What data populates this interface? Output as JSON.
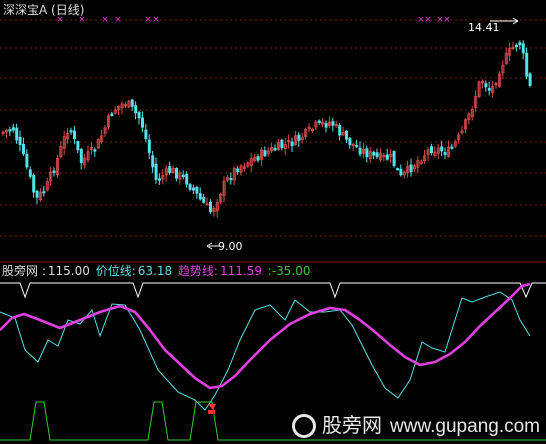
{
  "window": {
    "title": "深深宝A (日线)"
  },
  "price_panel": {
    "high_label": "14.41",
    "low_label": "9.00"
  },
  "indicator": {
    "name_label": "股旁网 :",
    "name_value": "115.00",
    "price_line_label": "价位线:",
    "price_line_value": "63.18",
    "trend_line_label": "趋势线:",
    "trend_line_value": "111.59",
    "extra_value": ":-35.00"
  },
  "colors": {
    "background": "#000000",
    "up_candle": "#d84b4b",
    "down_candle": "#54e2e8",
    "trend_line": "#e040e0",
    "price_line": "#54e2e8",
    "signal_line": "#35c935",
    "marker": "#e040e0",
    "white": "#ffffff",
    "grid": "#7a1a1a"
  },
  "watermark": {
    "brand": "股旁网",
    "site": "www.gupang.com"
  }
}
